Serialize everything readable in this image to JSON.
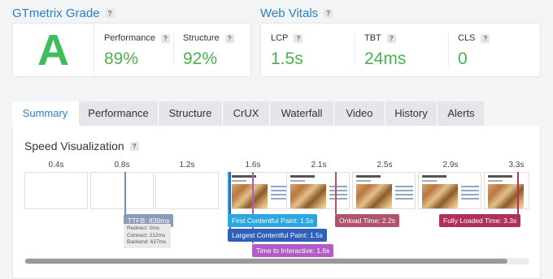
{
  "grade": {
    "title": "GTmetrix Grade",
    "help": "?",
    "letter": "A",
    "performance_label": "Performance",
    "performance_value": "89%",
    "structure_label": "Structure",
    "structure_value": "92%"
  },
  "vitals": {
    "title": "Web Vitals",
    "help": "?",
    "lcp_label": "LCP",
    "lcp_value": "1.5s",
    "tbt_label": "TBT",
    "tbt_value": "24ms",
    "cls_label": "CLS",
    "cls_value": "0"
  },
  "tabs": [
    "Summary",
    "Performance",
    "Structure",
    "CrUX",
    "Waterfall",
    "Video",
    "History",
    "Alerts"
  ],
  "active_tab": "Summary",
  "speed": {
    "title": "Speed Visualization",
    "help": "?",
    "ticks": [
      "0.4s",
      "0.8s",
      "1.2s",
      "1.6s",
      "2.1s",
      "2.5s",
      "2.9s",
      "3.3s"
    ],
    "markers": {
      "ttfb": "TTFB: 839ms",
      "ttfb_redirect": "Redirect: 0ms",
      "ttfb_connect": "Connect: 212ms",
      "ttfb_backend": "Backend: 627ms",
      "fcp": "First Contentful Paint: 1.5s",
      "lcp": "Largest Contentful Paint: 1.5s",
      "tti": "Time to Interactive: 1.6s",
      "onload": "Onload Time: 2.2s",
      "fully_loaded": "Fully Loaded Time: 3.3s"
    }
  },
  "colors": {
    "accent": "#2980c9",
    "grade_green": "#3dbd5e",
    "value_green": "#4caf50",
    "ttfb": "#8a9bb8",
    "fcp": "#2aa6e0",
    "lcp": "#2f5fb8",
    "tti": "#b35cc8",
    "onload": "#b0546e",
    "fully_loaded": "#b0305c"
  }
}
